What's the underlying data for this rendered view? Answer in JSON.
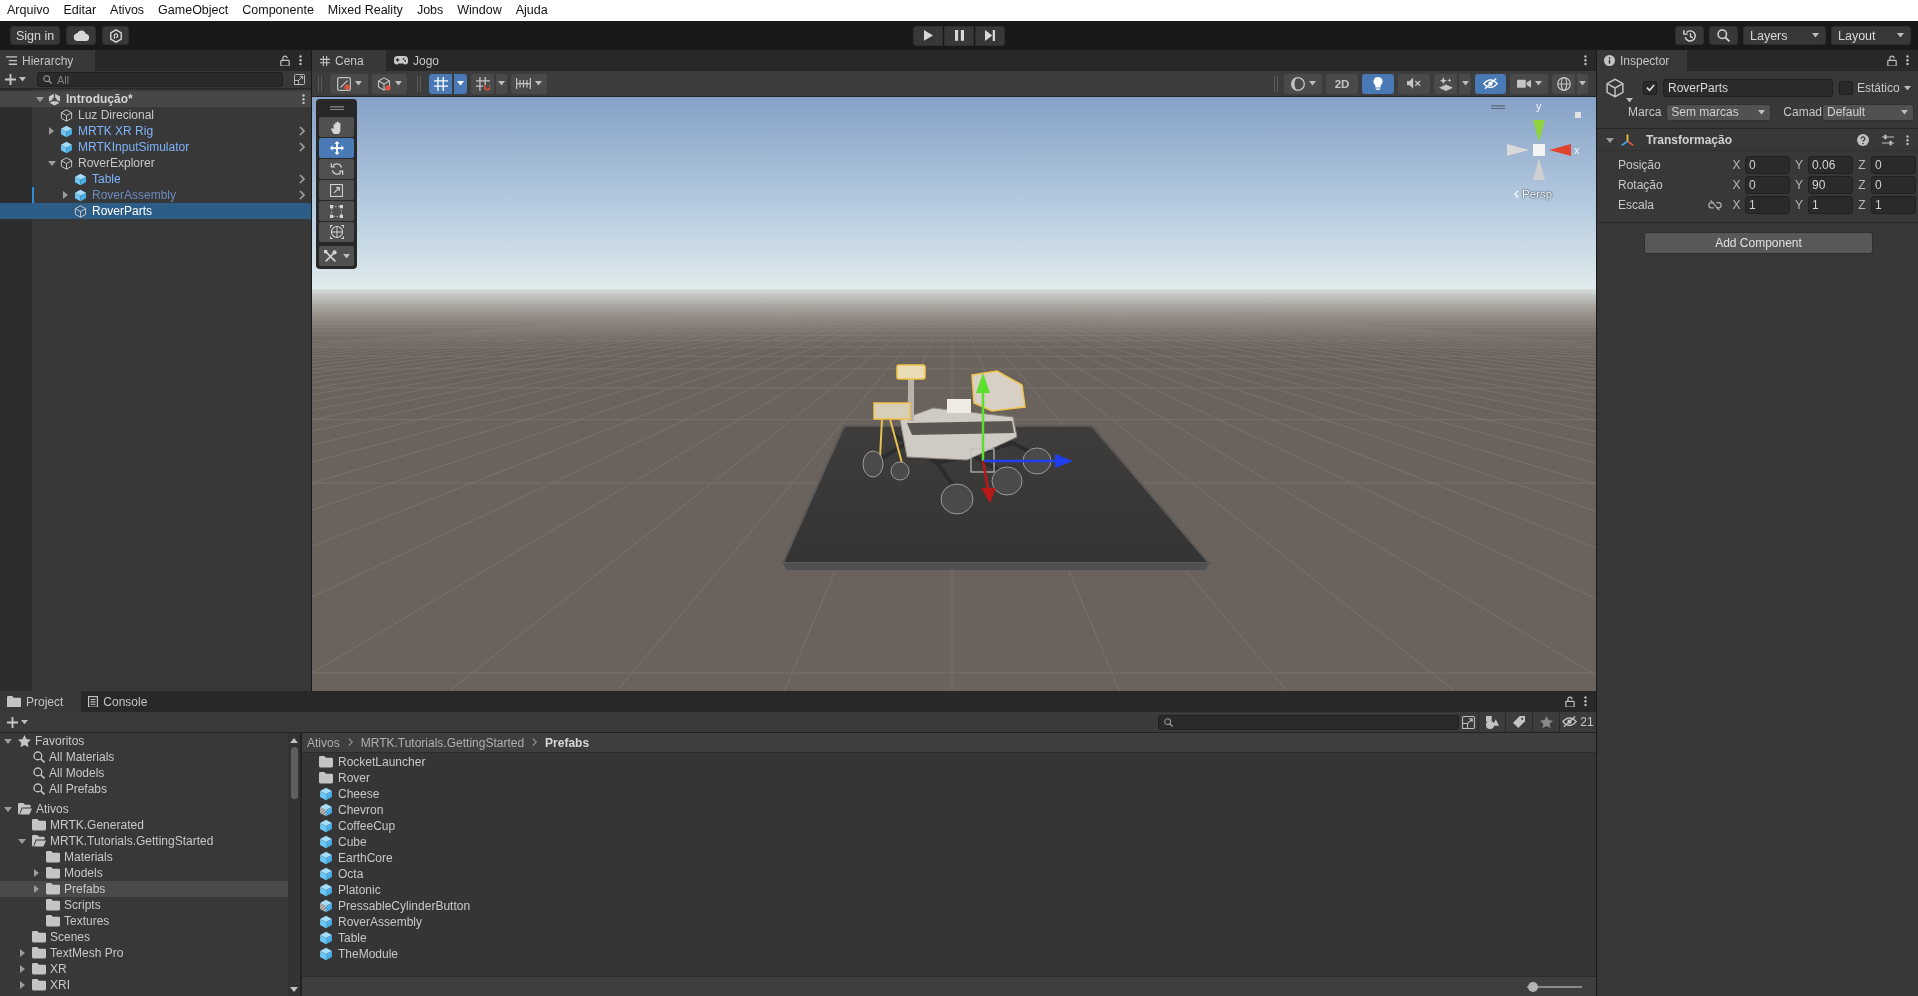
{
  "menu_bar": [
    "Arquivo",
    "Editar",
    "Ativos",
    "GameObject",
    "Componente",
    "Mixed Reality",
    "Jobs",
    "Window",
    "Ajuda"
  ],
  "toolbar": {
    "account": "Sign in",
    "layers": "Layers",
    "layout": "Layout"
  },
  "hierarchy": {
    "title": "Hierarchy",
    "search": {
      "placeholder": "All"
    },
    "scene": {
      "label": "Introdução*",
      "expanded": true,
      "children": [
        {
          "label": "Luz Direcional",
          "kind": "object",
          "selected": false,
          "modified": false,
          "inactive": false
        },
        {
          "label": "MRTK XR Rig",
          "kind": "prefab",
          "expanded": false,
          "selected": false,
          "modified": false,
          "inactive": false
        },
        {
          "label": "MRTKInputSimulator",
          "kind": "prefab",
          "selected": false,
          "modified": false,
          "inactive": false
        },
        {
          "label": "RoverExplorer",
          "kind": "object",
          "expanded": true,
          "selected": false,
          "modified": false,
          "inactive": false,
          "children": [
            {
              "label": "Table",
              "kind": "prefab",
              "selected": false,
              "modified": false,
              "inactive": false
            },
            {
              "label": "RoverAssembly",
              "kind": "prefab",
              "expanded": false,
              "selected": false,
              "modified": true,
              "inactive": true
            },
            {
              "label": "RoverParts",
              "kind": "object",
              "selected": true,
              "modified": false,
              "inactive": false
            }
          ]
        }
      ]
    }
  },
  "scene_view": {
    "tabs": [
      {
        "label": "Cena",
        "kind": "scene",
        "selected": true
      },
      {
        "label": "Jogo",
        "kind": "game",
        "selected": false
      }
    ],
    "toolbar_left": [
      {
        "kind": "draw",
        "on": false
      },
      {
        "kind": "view",
        "on": false
      },
      {
        "kind": "grid",
        "on": true
      },
      {
        "kind": "snap",
        "on": false
      },
      {
        "kind": "increment",
        "on": false
      }
    ],
    "toolbar_right": [
      {
        "kind": "shading",
        "on": false
      },
      {
        "kind": "dimension",
        "label": "2D",
        "on": false
      },
      {
        "kind": "lighting",
        "on": true
      },
      {
        "kind": "audio",
        "on": false
      },
      {
        "kind": "effects",
        "on": false
      },
      {
        "kind": "visibility",
        "on": true
      },
      {
        "kind": "camera",
        "on": false
      },
      {
        "kind": "gizmos",
        "on": false
      }
    ],
    "tools": [
      {
        "kind": "hand",
        "selected": false
      },
      {
        "kind": "move",
        "selected": true
      },
      {
        "kind": "rotate",
        "selected": false
      },
      {
        "kind": "scale",
        "selected": false
      },
      {
        "kind": "rect",
        "selected": false
      },
      {
        "kind": "transform",
        "selected": false
      },
      {
        "kind": "custom",
        "selected": false
      }
    ],
    "gizmo": {
      "axes": [
        "y",
        "x"
      ],
      "projection": "Persp"
    }
  },
  "inspector": {
    "title": "Inspector",
    "object": {
      "active": true,
      "name": "RoverParts",
      "static": false,
      "static_label": "Estático",
      "tag_label": "Marca",
      "tag": "Sem marcas",
      "layer_label": "Camad",
      "layer": "Default"
    },
    "components": [
      {
        "title": "Transformação",
        "expanded": true,
        "scale_constrained": false,
        "rows": [
          {
            "label": "Posição",
            "kind": "position",
            "values": [
              {
                "axis": "X",
                "value": "0"
              },
              {
                "axis": "Y",
                "value": "0.06"
              },
              {
                "axis": "Z",
                "value": "0"
              }
            ]
          },
          {
            "label": "Rotação",
            "kind": "rotation",
            "values": [
              {
                "axis": "X",
                "value": "0"
              },
              {
                "axis": "Y",
                "value": "90"
              },
              {
                "axis": "Z",
                "value": "0"
              }
            ]
          },
          {
            "label": "Escala",
            "kind": "scale",
            "values": [
              {
                "axis": "X",
                "value": "1"
              },
              {
                "axis": "Y",
                "value": "1"
              },
              {
                "axis": "Z",
                "value": "1"
              }
            ]
          }
        ]
      }
    ],
    "add_component": "Add Component"
  },
  "project": {
    "tabs": [
      {
        "label": "Project",
        "kind": "project",
        "selected": true
      },
      {
        "label": "Console",
        "kind": "console",
        "selected": false
      }
    ],
    "hidden_count": "21",
    "tree": [
      {
        "label": "Favoritos",
        "kind": "favorites",
        "expanded": true,
        "selected": false,
        "children": [
          {
            "label": "All Materials",
            "kind": "search",
            "selected": false
          },
          {
            "label": "All Models",
            "kind": "search",
            "selected": false
          },
          {
            "label": "All Prefabs",
            "kind": "search",
            "selected": false
          }
        ]
      },
      {
        "label": "Ativos",
        "kind": "folder",
        "expanded": true,
        "selected": false,
        "children": [
          {
            "label": "MRTK.Generated",
            "kind": "folder",
            "selected": false
          },
          {
            "label": "MRTK.Tutorials.GettingStarted",
            "kind": "folder",
            "expanded": true,
            "selected": false,
            "children": [
              {
                "label": "Materials",
                "kind": "folder",
                "selected": false
              },
              {
                "label": "Models",
                "kind": "folder",
                "expanded": false,
                "selected": false
              },
              {
                "label": "Prefabs",
                "kind": "folder",
                "expanded": false,
                "selected": true
              },
              {
                "label": "Scripts",
                "kind": "folder",
                "selected": false
              },
              {
                "label": "Textures",
                "kind": "folder",
                "selected": false
              }
            ]
          },
          {
            "label": "Scenes",
            "kind": "folder",
            "selected": false
          },
          {
            "label": "TextMesh Pro",
            "kind": "folder",
            "expanded": false,
            "selected": false
          },
          {
            "label": "XR",
            "kind": "folder",
            "expanded": false,
            "selected": false
          },
          {
            "label": "XRI",
            "kind": "folder",
            "expanded": false,
            "selected": false
          }
        ]
      }
    ],
    "breadcrumb": [
      "Ativos",
      "MRTK.Tutorials.GettingStarted",
      "Prefabs"
    ],
    "items": [
      {
        "label": "RocketLauncher",
        "kind": "folder"
      },
      {
        "label": "Rover",
        "kind": "folder"
      },
      {
        "label": "Cheese",
        "kind": "prefab"
      },
      {
        "label": "Chevron",
        "kind": "variant"
      },
      {
        "label": "CoffeeCup",
        "kind": "prefab"
      },
      {
        "label": "Cube",
        "kind": "prefab"
      },
      {
        "label": "EarthCore",
        "kind": "prefab"
      },
      {
        "label": "Octa",
        "kind": "prefab"
      },
      {
        "label": "Platonic",
        "kind": "prefab"
      },
      {
        "label": "PressableCylinderButton",
        "kind": "variant"
      },
      {
        "label": "RoverAssembly",
        "kind": "prefab"
      },
      {
        "label": "Table",
        "kind": "prefab"
      },
      {
        "label": "TheModule",
        "kind": "prefab"
      }
    ],
    "zoom": {
      "level": 0.1
    }
  }
}
